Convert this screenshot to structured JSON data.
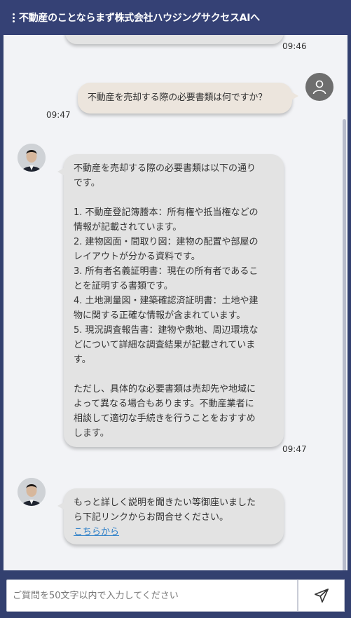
{
  "header": {
    "menu_icon": "kebab-menu-icon",
    "title": "不動産のことならまず株式会社ハウジングサクセスAIへ"
  },
  "messages": {
    "prev_time": "09:46",
    "user": {
      "text": "不動産を売却する際の必要書類は何ですか？",
      "time": "09:47",
      "avatar_icon": "user-avatar-icon"
    },
    "bot1": {
      "lines": [
        "不動産を売却する際の必要書類は以下の通り",
        "です。",
        "",
        "1. 不動産登記簿謄本：所有権や抵当権などの",
        "情報が記載されています。",
        "2. 建物図面・間取り図：建物の配置や部屋の",
        "レイアウトが分かる資料です。",
        "3. 所有者名義証明書：現在の所有者であるこ",
        "とを証明する書類です。",
        "4. 土地測量図・建築確認済証明書：土地や建",
        "物に関する正確な情報が含まれています。",
        "5. 現況調査報告書：建物や敷地、周辺環境な",
        "どについて詳細な調査結果が記載されていま",
        "す。",
        "",
        "ただし、具体的な必要書類は売却先や地域に",
        "よって異なる場合もあります。不動産業者に",
        "相談して適切な手続きを行うことをおすすめ",
        "します。"
      ],
      "time": "09:47"
    },
    "bot2": {
      "lines": [
        "もっと詳しく説明を聞きたい等御座いました",
        "ら下記リンクからお問合せください。"
      ],
      "link_label": "こちらから"
    }
  },
  "input": {
    "placeholder": "ご質問を50文字以内で入力してください",
    "value": ""
  },
  "send_icon": "paper-plane-icon",
  "colors": {
    "header_bg": "#354175",
    "chat_bg": "#f2f3f6",
    "bot_bubble": "#e3e3e3",
    "user_bubble": "#ece5dd",
    "link": "#2a7ec8"
  }
}
